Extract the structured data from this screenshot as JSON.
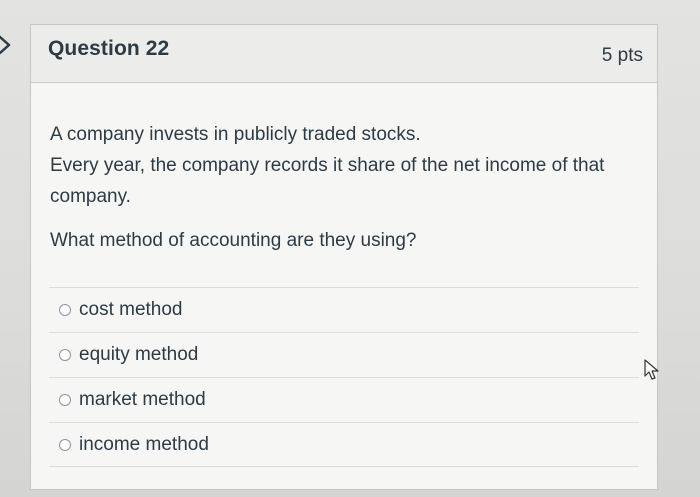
{
  "question": {
    "title": "Question 22",
    "points": "5 pts",
    "text_lines": [
      "A company invests in publicly traded stocks.",
      "Every year, the company records it share of the net income of that company."
    ],
    "prompt": "What method of accounting are they using?"
  },
  "answers": [
    {
      "label": "cost method",
      "selected": false
    },
    {
      "label": "equity method",
      "selected": false
    },
    {
      "label": "market method",
      "selected": false
    },
    {
      "label": "income method",
      "selected": false
    }
  ],
  "icons": {
    "nav": "chevron-right-icon",
    "pointer": "mouse-cursor-icon",
    "answer_control": "radio-button-icon"
  },
  "colors": {
    "text": "#2d3b45",
    "header_bg": "#ececea",
    "card_bg": "#f6f6f4",
    "border": "#c4c7c9"
  }
}
